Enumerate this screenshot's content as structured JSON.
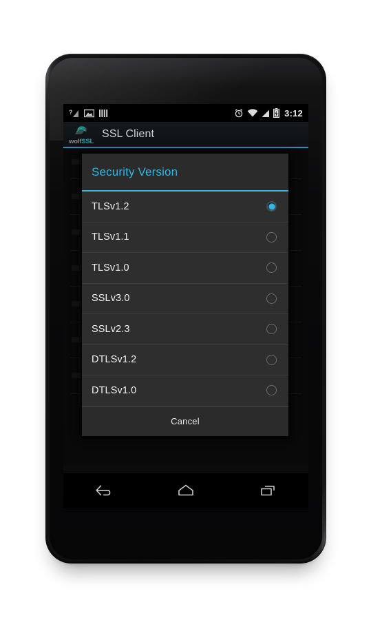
{
  "device": {
    "name": "android-phone-mockup"
  },
  "status_bar": {
    "left_icons": [
      {
        "name": "no-sim-signal-icon",
        "label": "signal-unknown"
      },
      {
        "name": "screenshot-icon",
        "label": "image"
      },
      {
        "name": "vpn-bars-icon",
        "label": "bars"
      }
    ],
    "right_icons": [
      {
        "name": "alarm-icon",
        "label": "alarm"
      },
      {
        "name": "wifi-icon",
        "label": "wifi"
      },
      {
        "name": "cellular-signal-icon",
        "label": "signal"
      },
      {
        "name": "battery-charging-icon",
        "label": "battery-charging"
      }
    ],
    "clock": "3:12"
  },
  "action_bar": {
    "logo_text_primary": "wolf",
    "logo_text_accent": "SSL",
    "title": "SSL Client",
    "accent_color": "#2592b5"
  },
  "dialog": {
    "title": "Security Version",
    "accent_color": "#33b5e5",
    "options": [
      {
        "label": "TLSv1.2",
        "selected": true
      },
      {
        "label": "TLSv1.1",
        "selected": false
      },
      {
        "label": "TLSv1.0",
        "selected": false
      },
      {
        "label": "SSLv3.0",
        "selected": false
      },
      {
        "label": "SSLv2.3",
        "selected": false
      },
      {
        "label": "DTLSv1.2",
        "selected": false
      },
      {
        "label": "DTLSv1.0",
        "selected": false
      }
    ],
    "cancel_label": "Cancel"
  },
  "nav_bar": {
    "buttons": [
      {
        "name": "back-button",
        "label": "Back"
      },
      {
        "name": "home-button",
        "label": "Home"
      },
      {
        "name": "recents-button",
        "label": "Recent apps"
      }
    ]
  }
}
